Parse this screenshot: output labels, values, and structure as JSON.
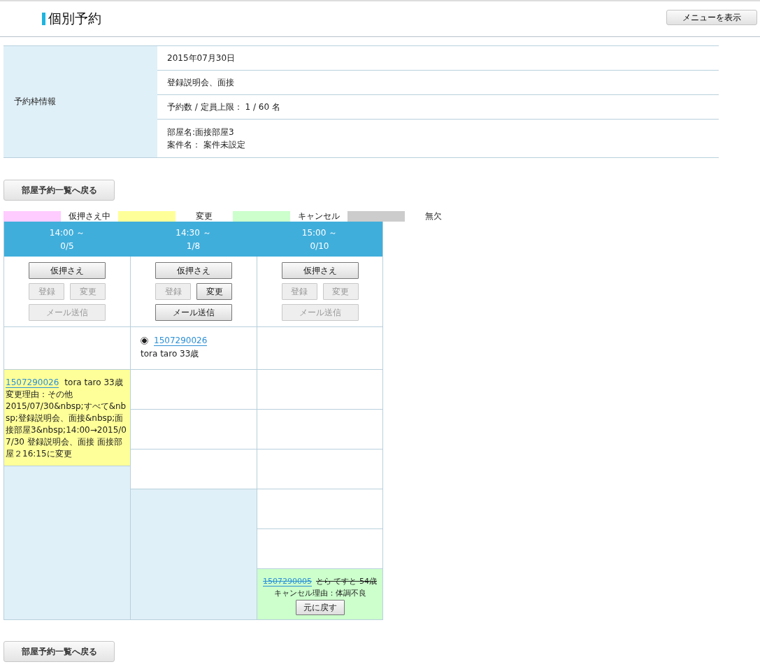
{
  "header": {
    "title": "個別予約",
    "menu_button": "メニューを表示"
  },
  "info": {
    "label": "予約枠情報",
    "rows": [
      {
        "lines": [
          "2015年07月30日"
        ]
      },
      {
        "lines": [
          "登録説明会、面接"
        ]
      },
      {
        "lines": [
          "予約数 / 定員上限： 1 / 60 名"
        ]
      },
      {
        "lines": [
          "部屋名:面接部屋3",
          "案件名： 案件未設定"
        ]
      }
    ]
  },
  "back_button_top": "部屋予約一覧へ戻る",
  "legend": [
    {
      "label": "仮押さえ中",
      "color": "#ffccff"
    },
    {
      "label": "変更",
      "color": "#ffff99"
    },
    {
      "label": "キャンセル",
      "color": "#ccffcc"
    },
    {
      "label": "無欠",
      "color": "#cccccc"
    }
  ],
  "slots": [
    {
      "time": "14:00 ～",
      "count": "0/5",
      "buttons": [
        {
          "label": "仮押さえ",
          "disabled": false,
          "wide": true
        },
        {
          "label": "登録",
          "disabled": true,
          "wide": false
        },
        {
          "label": "変更",
          "disabled": true,
          "wide": false
        },
        {
          "label": "メール送信",
          "disabled": true,
          "wide": true
        }
      ],
      "cells": [
        {
          "kind": "blank"
        },
        {
          "kind": "change",
          "id": "1507290026",
          "name": "tora taro  33歳",
          "reason": "変更理由：その他",
          "detail": "2015/07/30&nbsp;すべて&nbsp;登録説明会、面接&nbsp;面接部屋3&nbsp;14:00→2015/07/30 登録説明会、面接 面接部屋２16:15に変更"
        }
      ]
    },
    {
      "time": "14:30 ～",
      "count": "1/8",
      "buttons": [
        {
          "label": "仮押さえ",
          "disabled": false,
          "wide": true
        },
        {
          "label": "登録",
          "disabled": true,
          "wide": false
        },
        {
          "label": "変更",
          "disabled": false,
          "wide": false
        },
        {
          "label": "メール送信",
          "disabled": false,
          "wide": true
        }
      ],
      "cells": [
        {
          "kind": "reserved",
          "selected": true,
          "id": "1507290026",
          "name": "tora taro  33歳"
        },
        {
          "kind": "empty"
        },
        {
          "kind": "empty"
        },
        {
          "kind": "empty"
        }
      ]
    },
    {
      "time": "15:00 ～",
      "count": "0/10",
      "buttons": [
        {
          "label": "仮押さえ",
          "disabled": false,
          "wide": true
        },
        {
          "label": "登録",
          "disabled": true,
          "wide": false
        },
        {
          "label": "変更",
          "disabled": true,
          "wide": false
        },
        {
          "label": "メール送信",
          "disabled": true,
          "wide": true
        }
      ],
      "cells": [
        {
          "kind": "blank"
        },
        {
          "kind": "empty"
        },
        {
          "kind": "empty"
        },
        {
          "kind": "empty"
        },
        {
          "kind": "empty"
        },
        {
          "kind": "empty"
        },
        {
          "kind": "cancel",
          "id": "1507290005",
          "name": "とら てすと 54歳",
          "reason": "キャンセル理由：体調不良",
          "button": "元に戻す"
        }
      ]
    }
  ],
  "back_button_bottom": "部屋予約一覧へ戻る"
}
